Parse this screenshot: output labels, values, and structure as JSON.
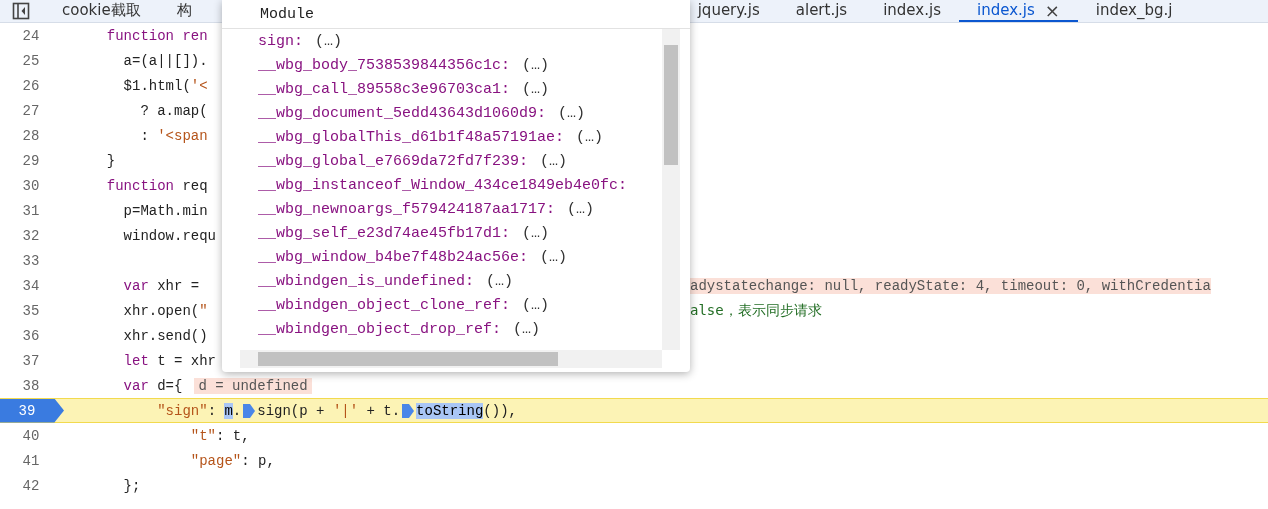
{
  "tabs_left": [
    {
      "label": "cookie截取",
      "selected": false
    },
    {
      "label": "构",
      "selected": false
    }
  ],
  "tabs_right": [
    {
      "label": "jquery.js",
      "selected": false
    },
    {
      "label": "alert.js",
      "selected": false
    },
    {
      "label": "index.js",
      "selected": false
    },
    {
      "label": "index.js",
      "selected": true,
      "close": "×"
    },
    {
      "label": "index_bg.j",
      "selected": false
    }
  ],
  "lines": [
    {
      "number": "24",
      "paused": false,
      "tokens": [
        {
          "text": "  function ren",
          "kind": "keyword"
        }
      ]
    },
    {
      "number": "25",
      "paused": false,
      "tokens": [
        {
          "text": "    a=(a||[]).",
          "kind": "plain"
        }
      ]
    },
    {
      "number": "26",
      "paused": false,
      "tokens": [
        {
          "text": "    $1.html(",
          "kind": "plain"
        },
        {
          "text": "'<",
          "kind": "string"
        }
      ]
    },
    {
      "number": "27",
      "paused": false,
      "tokens": [
        {
          "text": "      ? a.map(",
          "kind": "plain"
        }
      ]
    },
    {
      "number": "28",
      "paused": false,
      "tokens": [
        {
          "text": "      : ",
          "kind": "plain"
        },
        {
          "text": "'<span",
          "kind": "string"
        }
      ]
    },
    {
      "number": "29",
      "paused": false,
      "tokens": [
        {
          "text": "  }",
          "kind": "plain"
        }
      ]
    },
    {
      "number": "30",
      "paused": false,
      "tokens": [
        {
          "text": "  function",
          "kind": "keyword"
        },
        {
          "text": " req",
          "kind": "plain"
        }
      ]
    },
    {
      "number": "31",
      "paused": false,
      "tokens": [
        {
          "text": "    p=Math.min",
          "kind": "plain"
        }
      ]
    },
    {
      "number": "32",
      "paused": false,
      "tokens": [
        {
          "text": "    window.requ",
          "kind": "plain"
        }
      ]
    },
    {
      "number": "33",
      "paused": false
    },
    {
      "number": "34",
      "paused": false,
      "tokens": [
        {
          "text": "    var",
          "kind": "keyword"
        },
        {
          "text": " xhr =",
          "kind": "plain"
        }
      ],
      "right": {
        "text": "adystatechange: null, readyState: 4, timeout: 0, withCredentia",
        "kind": "value"
      }
    },
    {
      "number": "35",
      "paused": false,
      "tokens": [
        {
          "text": "    xhr.open(",
          "kind": "plain"
        },
        {
          "text": "\"",
          "kind": "string"
        }
      ],
      "right": {
        "text": "alse，表示同步请求",
        "kind": "comment"
      }
    },
    {
      "number": "36",
      "paused": false,
      "tokens": [
        {
          "text": "    xhr.send()",
          "kind": "plain"
        }
      ]
    },
    {
      "number": "37",
      "paused": false,
      "tokens": [
        {
          "text": "    let",
          "kind": "keyword"
        },
        {
          "text": " t = xhr",
          "kind": "plain"
        }
      ]
    },
    {
      "number": "38",
      "paused": false,
      "tokens": [
        {
          "text": "    var",
          "kind": "keyword"
        },
        {
          "text": " d={",
          "kind": "plain"
        }
      ],
      "inline_value": "d = undefined"
    },
    {
      "number": "39",
      "paused": true,
      "tokens": [
        {
          "text": "        \"sign\"",
          "kind": "string"
        },
        {
          "text": ": ",
          "kind": "plain"
        },
        {
          "text": "m",
          "kind": "selected"
        },
        {
          "text": ".",
          "kind": "plain"
        },
        {
          "kind": "step"
        },
        {
          "text": "sign(p + ",
          "kind": "plain"
        },
        {
          "text": "'|'",
          "kind": "string"
        },
        {
          "text": " + t.",
          "kind": "plain"
        },
        {
          "kind": "step"
        },
        {
          "text": "toString",
          "kind": "selected"
        },
        {
          "text": "()),",
          "kind": "plain"
        }
      ]
    },
    {
      "number": "40",
      "paused": false,
      "tokens": [
        {
          "text": "            \"t\"",
          "kind": "string"
        },
        {
          "text": ": t,",
          "kind": "plain"
        }
      ]
    },
    {
      "number": "41",
      "paused": false,
      "tokens": [
        {
          "text": "            \"page\"",
          "kind": "string"
        },
        {
          "text": ": p,",
          "kind": "plain"
        }
      ]
    },
    {
      "number": "42",
      "paused": false,
      "tokens": [
        {
          "text": "    };",
          "kind": "plain"
        }
      ]
    }
  ],
  "popover": {
    "title": "Module",
    "items": [
      {
        "name": "sign:",
        "value": "(…)"
      },
      {
        "name": "__wbg_body_7538539844356c1c:",
        "value": "(…)"
      },
      {
        "name": "__wbg_call_89558c3e96703ca1:",
        "value": "(…)"
      },
      {
        "name": "__wbg_document_5edd43643d1060d9:",
        "value": "(…)"
      },
      {
        "name": "__wbg_globalThis_d61b1f48a57191ae:",
        "value": "(…)"
      },
      {
        "name": "__wbg_global_e7669da72fd7f239:",
        "value": "(…)"
      },
      {
        "name": "__wbg_instanceof_Window_434ce1849eb4e0fc:"
      },
      {
        "name": "__wbg_newnoargs_f579424187aa1717:",
        "value": "(…)"
      },
      {
        "name": "__wbg_self_e23d74ae45fb17d1:",
        "value": "(…)"
      },
      {
        "name": "__wbg_window_b4be7f48b24ac56e:",
        "value": "(…)"
      },
      {
        "name": "__wbindgen_is_undefined:",
        "value": "(…)"
      },
      {
        "name": "__wbindgen_object_clone_ref:",
        "value": "(…)"
      },
      {
        "name": "__wbindgen_object_drop_ref:",
        "value": "(…)"
      }
    ]
  }
}
